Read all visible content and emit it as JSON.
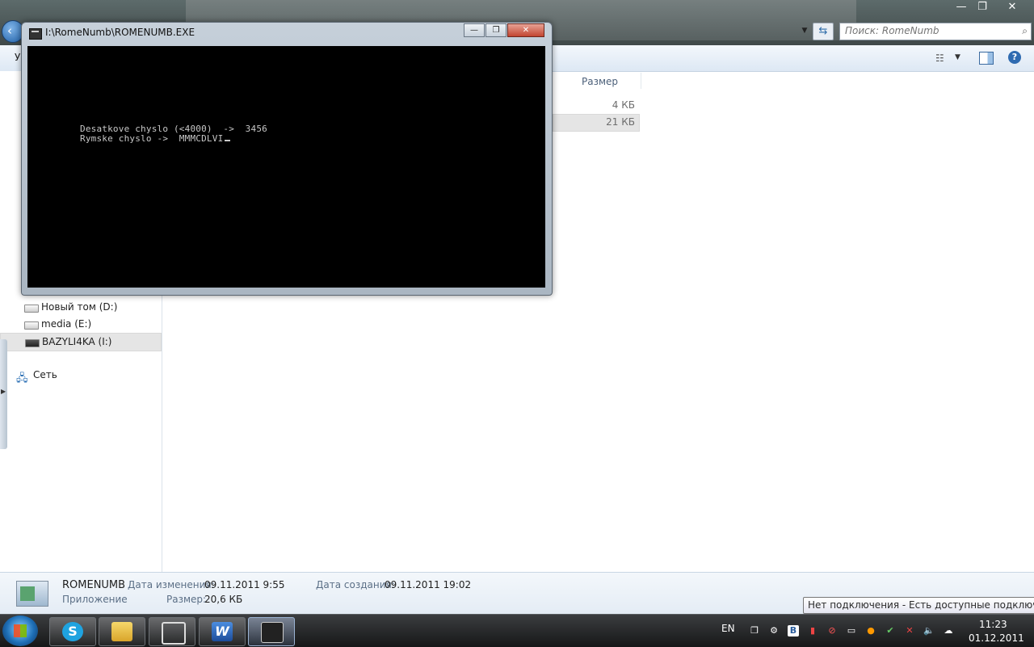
{
  "explorer": {
    "search_placeholder": "Поиск: RomeNumb",
    "cmd_partial": "У",
    "column_size": "Размер",
    "files": [
      {
        "size": "4 КБ"
      },
      {
        "size": "21 КБ"
      }
    ],
    "nav": {
      "drives": [
        {
          "label": "Новый том (D:)"
        },
        {
          "label": "media (E:)"
        },
        {
          "label": "BAZYLI4KA (I:)"
        }
      ],
      "network": "Сеть"
    },
    "details": {
      "name": "ROMENUMB",
      "type": "Приложение",
      "modified_label": "Дата изменения:",
      "modified_value": "09.11.2011 9:55",
      "created_label": "Дата создания:",
      "created_value": "09.11.2011 19:02",
      "size_label": "Размер:",
      "size_value": "20,6 КБ"
    }
  },
  "console": {
    "title": "I:\\RomeNumb\\ROMENUMB.EXE",
    "line1": "Desatkove chyslo (<4000)  ->  3456",
    "line2": "Rymske chyslo ->  MMMCDLVI"
  },
  "window_controls": {
    "minimize": "—",
    "maximize": "❐",
    "close": "✕"
  },
  "taskbar": {
    "lang": "EN",
    "time": "11:23",
    "date": "01.12.2011",
    "tooltip": "Нет подключения - Есть доступные подключения",
    "apps": [
      "skype-icon",
      "explorer-icon",
      "multitask-icon",
      "word-icon",
      "console-icon"
    ]
  }
}
